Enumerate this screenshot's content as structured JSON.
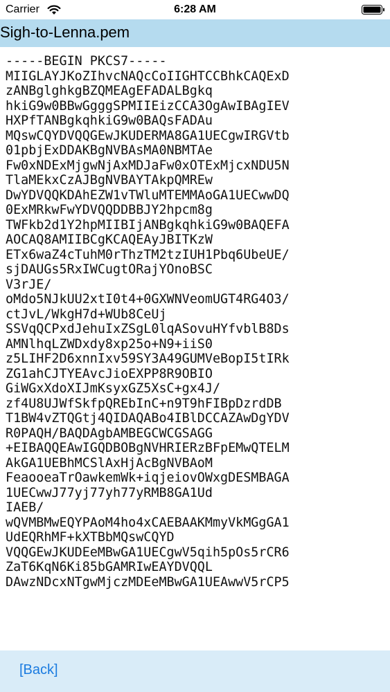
{
  "status_bar": {
    "carrier": "Carrier",
    "time": "6:28 AM"
  },
  "title_bar": {
    "title": "Sigh-to-Lenna.pem"
  },
  "content": {
    "lines": [
      "-----BEGIN PKCS7-----",
      "MIIGLAYJKoZIhvcNAQcCoIIGHTCCBhkCAQExD",
      "zANBglghkgBZQMEAgEFADALBgkq",
      "hkiG9w0BBwGgggSPMIIEizCCA3OgAwIBAgIEV",
      "HXPfTANBgkqhkiG9w0BAQsFADAu",
      "MQswCQYDVQQGEwJKUDERMA8GA1UECgwIRGVtb",
      "01pbjExDDAKBgNVBAsMA0NBMTAe",
      "Fw0xNDExMjgwNjAxMDJaFw0xOTExMjcxNDU5N",
      "TlaMEkxCzAJBgNVBAYTAkpQMREw",
      "DwYDVQQKDAhEZW1vTWluMTEMMAoGA1UECwwDQ",
      "0ExMRkwFwYDVQQDDBBJY2hpcm8g",
      "TWFkb2d1Y2hpMIIBIjANBgkqhkiG9w0BAQEFA",
      "AOCAQ8AMIIBCgKCAQEAyJBITKzW",
      "ETx6waZ4cTuhM0rThzTM2tzIUH1Pbq6UbeUE/",
      "sjDAUGs5RxIWCugtORajYOnoBSC",
      "V3rJE/",
      "oMdo5NJkUU2xtI0t4+0GXWNVeomUGT4RG4O3/",
      "ctJvL/WkgH7d+WUb8CeUj",
      "SSVqQCPxdJehuIxZSgL0lqASovuHYfvblB8Ds",
      "AMNlhqLZWDxdy8xp25o+N9+iiS0",
      "z5LIHF2D6xnnIxv59SY3A49GUMVeBopI5tIRk",
      "ZG1ahCJTYEAvcJioEXPP8R9OBIO",
      "GiWGxXdoXIJmKsyxGZ5XsC+gx4J/",
      "zf4U8UJWfSkfpQREbInC+n9T9hFIBpDzrdDB",
      "T1BW4vZTQGtj4QIDAQABo4IBlDCCAZAwDgYDV",
      "R0PAQH/BAQDAgbAMBEGCWCGSAGG",
      "+EIBAQQEAwIGQDBOBgNVHRIERzBFpEMwQTELM",
      "AkGA1UEBhMCSlAxHjAcBgNVBAoM",
      "FeaooeaTrOawkemWk+iqjeiovOWxgDESMBAGA",
      "1UECwwJ77yj77yh77yRMB8GA1Ud",
      "IAEB/",
      "wQVMBMwEQYPAoM4ho4xCAEBAAKMmyVkMGgGA1",
      "UdEQRhMF+kXTBbMQswCQYD",
      "VQQGEwJKUDEeMBwGA1UECgwV5qih5pOs5rCR6",
      "ZaT6KqN6Ki85bGAMRIwEAYDVQQL",
      "DAwzNDcxNTgwMjczMDEeMBwGA1UEAwwV5rCP5"
    ]
  },
  "bottom_bar": {
    "back_label": "[Back]"
  }
}
